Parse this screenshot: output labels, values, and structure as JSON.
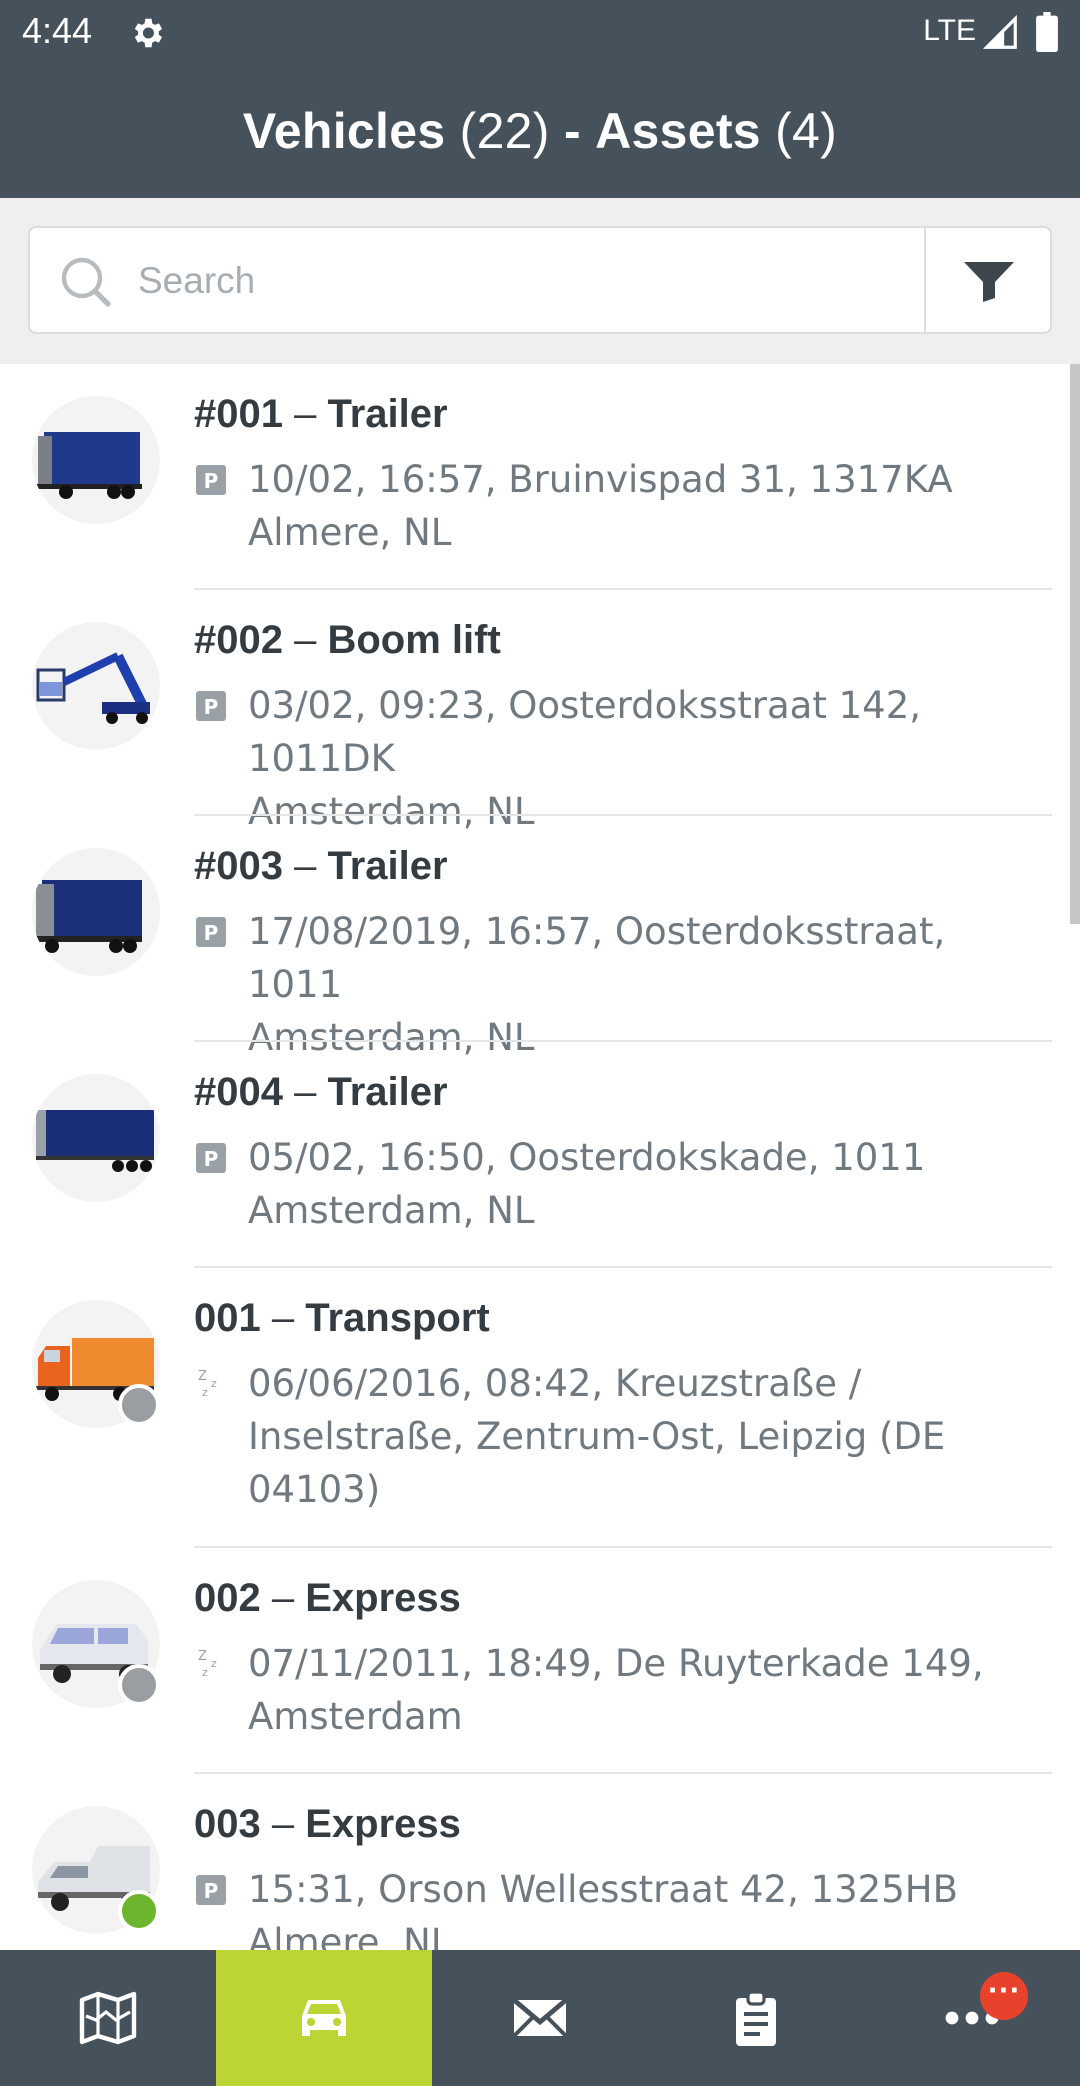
{
  "status": {
    "time": "4:44",
    "network": "LTE"
  },
  "header": {
    "vehicles_label": "Vehicles",
    "vehicles_count": "(22)",
    "separator": "-",
    "assets_label": "Assets",
    "assets_count": "(4)"
  },
  "search": {
    "placeholder": "Search",
    "value": ""
  },
  "items": [
    {
      "id": "#001",
      "name": "Trailer",
      "status_icon": "parking-icon",
      "line1": "10/02, 16:57, Bruinvispad 31, 1317KA",
      "line2": "Almere, NL",
      "line3": ""
    },
    {
      "id": "#002",
      "name": "Boom lift",
      "status_icon": "parking-icon",
      "line1": "03/02, 09:23, Oosterdoksstraat 142, 1011DK",
      "line2": "Amsterdam, NL",
      "line3": ""
    },
    {
      "id": "#003",
      "name": "Trailer",
      "status_icon": "parking-icon",
      "line1": "17/08/2019, 16:57, Oosterdoksstraat, 1011",
      "line2": "Amsterdam, NL",
      "line3": ""
    },
    {
      "id": "#004",
      "name": "Trailer",
      "status_icon": "parking-icon",
      "line1": "05/02, 16:50, Oosterdokskade, 1011",
      "line2": "Amsterdam, NL",
      "line3": ""
    },
    {
      "id": "001",
      "name": "Transport",
      "status_icon": "sleep-icon",
      "line1": "06/06/2016, 08:42, Kreuzstraße /",
      "line2": "Inselstraße, Zentrum-Ost, Leipzig (DE",
      "line3": "04103)",
      "dot": "#9a9ea2"
    },
    {
      "id": "002",
      "name": "Express",
      "status_icon": "sleep-icon",
      "line1": "07/11/2011, 18:49, De Ruyterkade 149,",
      "line2": "Amsterdam",
      "line3": "",
      "dot": "#9a9ea2"
    },
    {
      "id": "003",
      "name": "Express",
      "status_icon": "parking-icon",
      "line1": "15:31, Orson Wellesstraat 42, 1325HB",
      "line2": "Almere, NL",
      "line3": "",
      "dot": "#6cb52d"
    }
  ],
  "nav": {
    "items": [
      "map-icon",
      "car-icon",
      "mail-icon",
      "clipboard-icon",
      "more-icon"
    ],
    "active": "car-icon",
    "badge": "···"
  },
  "colors": {
    "header_bg": "#45525c",
    "active_tab": "#bcd534",
    "badge": "#e8412c",
    "online": "#6cb52d",
    "offline": "#9a9ea2"
  }
}
